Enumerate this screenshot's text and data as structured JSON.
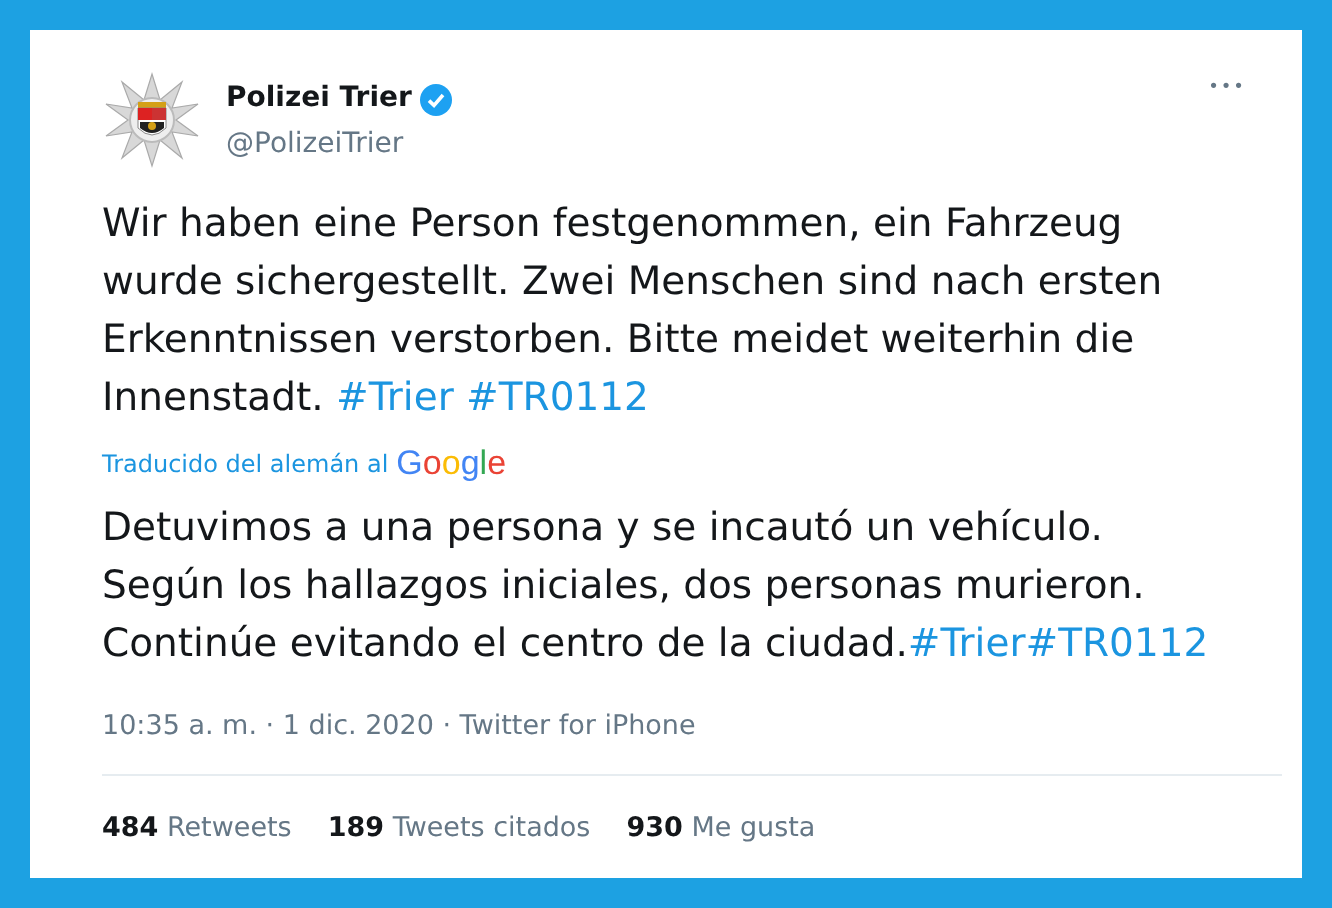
{
  "author": {
    "name": "Polizei Trier",
    "verified": true,
    "handle": "@PolizeiTrier"
  },
  "more_button": "•••",
  "tweet": [
    {
      "kind": "text",
      "text": "Wir haben eine Person festgenommen, ein Fahrzeug wurde sichergestellt. Zwei Menschen sind nach ersten Erkenntnissen verstorben. Bitte meidet weiterhin die Innenstadt. "
    },
    {
      "kind": "hashtag",
      "text": "#Trier #TR0112"
    }
  ],
  "translation_note": {
    "text": "Traducido del alemán al",
    "logo": "Google"
  },
  "translation": [
    {
      "kind": "text",
      "text": "Detuvimos a una persona y se incautó un vehículo. Según los hallazgos iniciales, dos personas murieron. Continúe evitando el centro de la ciudad."
    },
    {
      "kind": "hashtag",
      "text": "#Trier"
    },
    {
      "kind": "hashtag",
      "text": "#TR0112"
    }
  ],
  "meta": "10:35 a. m. · 1 dic. 2020 · Twitter for iPhone",
  "stats": [
    {
      "count": "484",
      "label": "Retweets"
    },
    {
      "count": "189",
      "label": "Tweets citados"
    },
    {
      "count": "930",
      "label": "Me gusta"
    }
  ]
}
